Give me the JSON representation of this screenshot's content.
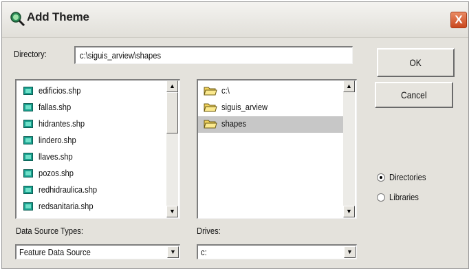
{
  "window": {
    "title": "Add Theme",
    "close_glyph": "X"
  },
  "directory": {
    "label": "Directory:",
    "value": "c:\\siguis_arview\\shapes"
  },
  "buttons": {
    "ok": "OK",
    "cancel": "Cancel"
  },
  "files": {
    "items": [
      {
        "name": "edificios.shp",
        "icon": "shapefile-icon"
      },
      {
        "name": "fallas.shp",
        "icon": "shapefile-icon"
      },
      {
        "name": "hidrantes.shp",
        "icon": "shapefile-icon"
      },
      {
        "name": "lindero.shp",
        "icon": "shapefile-icon"
      },
      {
        "name": "llaves.shp",
        "icon": "shapefile-icon"
      },
      {
        "name": "pozos.shp",
        "icon": "shapefile-icon"
      },
      {
        "name": "redhidraulica.shp",
        "icon": "shapefile-icon"
      },
      {
        "name": "redsanitaria.shp",
        "icon": "shapefile-icon"
      }
    ]
  },
  "folders": {
    "items": [
      {
        "name": "c:\\",
        "icon": "folder-open-icon",
        "selected": false
      },
      {
        "name": "siguis_arview",
        "icon": "folder-open-icon",
        "selected": false
      },
      {
        "name": "shapes",
        "icon": "folder-open-icon",
        "selected": true
      }
    ]
  },
  "data_source": {
    "label": "Data Source Types:",
    "value": "Feature Data Source"
  },
  "drives": {
    "label": "Drives:",
    "value": "c:"
  },
  "mode": {
    "options": [
      {
        "label": "Directories",
        "checked": true
      },
      {
        "label": "Libraries",
        "checked": false
      }
    ]
  },
  "scroll_glyphs": {
    "up": "▲",
    "down": "▼"
  },
  "colors": {
    "dialog_bg": "#e4e2dc",
    "close_button": "#c9471e",
    "shapefile_icon": "#1a9f8e",
    "folder_icon": "#f2d35c"
  }
}
